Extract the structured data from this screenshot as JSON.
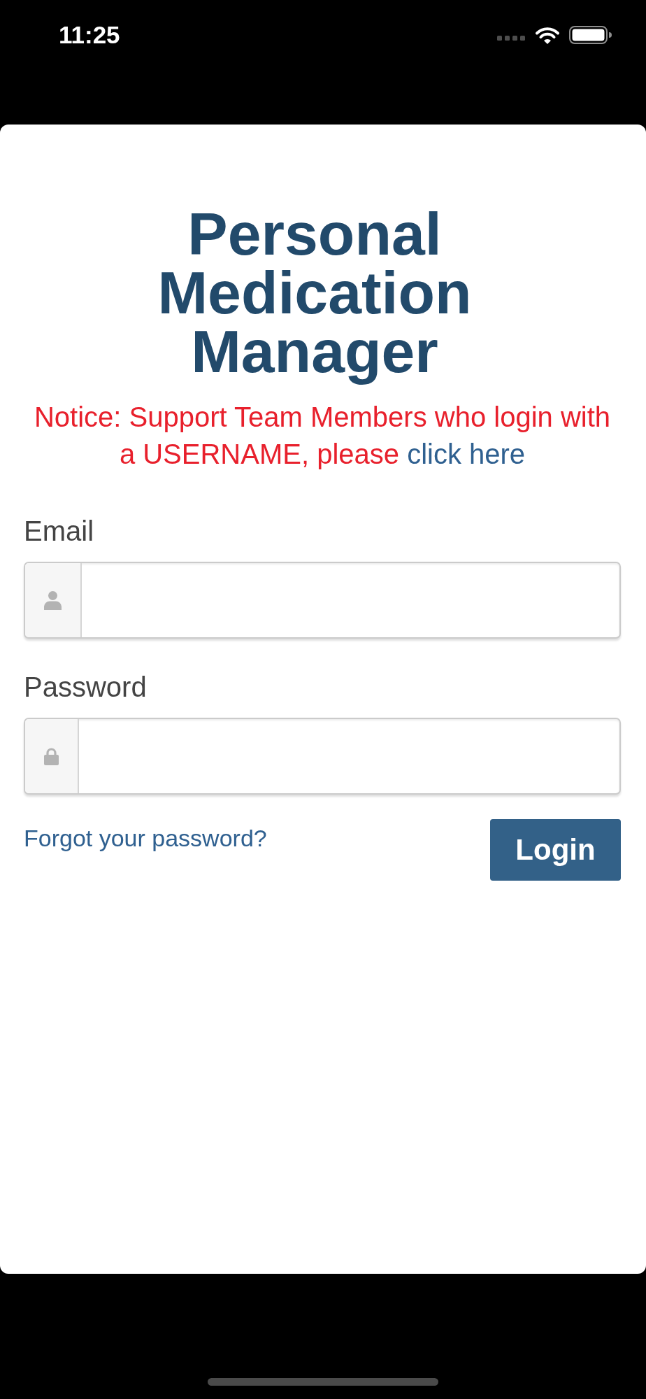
{
  "status_bar": {
    "time": "11:25"
  },
  "title": "Personal Medication Manager",
  "notice": {
    "text": "Notice: Support Team Members who login with a USERNAME, please",
    "link": "click here"
  },
  "fields": [
    {
      "kind": "email",
      "label": "Email"
    },
    {
      "kind": "password",
      "label": "Password"
    }
  ],
  "forgot_link": "Forgot your password?",
  "login_button": "Login"
}
